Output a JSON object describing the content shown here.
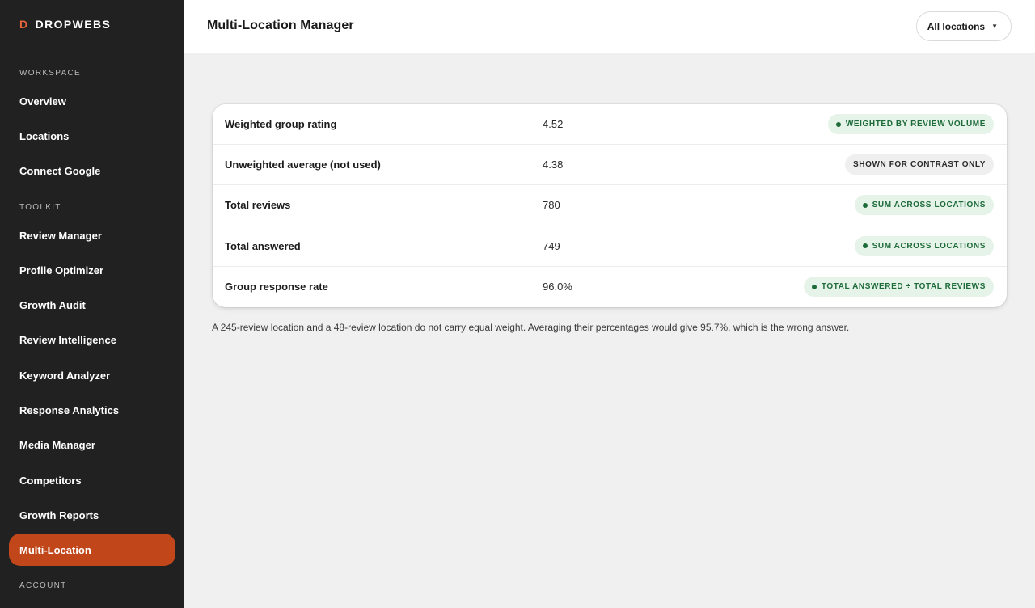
{
  "brand": {
    "mark": "D",
    "name": "DROPWEBS"
  },
  "sidebar": {
    "sections": [
      {
        "label": "WORKSPACE"
      },
      {
        "label": "TOOLKIT"
      },
      {
        "label": "ACCOUNT"
      }
    ],
    "items": [
      {
        "label": "Overview"
      },
      {
        "label": "Locations"
      },
      {
        "label": "Connect Google"
      },
      {
        "label": "Review Manager"
      },
      {
        "label": "Profile Optimizer"
      },
      {
        "label": "Growth Audit"
      },
      {
        "label": "Review Intelligence"
      },
      {
        "label": "Keyword Analyzer"
      },
      {
        "label": "Response Analytics"
      },
      {
        "label": "Media Manager"
      },
      {
        "label": "Competitors"
      },
      {
        "label": "Growth Reports"
      },
      {
        "label": "Multi-Location",
        "active": true
      }
    ]
  },
  "header": {
    "title": "Multi-Location Manager",
    "location_select": "All locations"
  },
  "rows": [
    {
      "label": "Weighted group rating",
      "value": "4.52",
      "badge": "WEIGHTED BY REVIEW VOLUME",
      "badge_style": "green"
    },
    {
      "label": "Unweighted average (not used)",
      "value": "4.38",
      "badge": "SHOWN FOR CONTRAST ONLY",
      "badge_style": "gray"
    },
    {
      "label": "Total reviews",
      "value": "780",
      "badge": "SUM ACROSS LOCATIONS",
      "badge_style": "green"
    },
    {
      "label": "Total answered",
      "value": "749",
      "badge": "SUM ACROSS LOCATIONS",
      "badge_style": "green"
    },
    {
      "label": "Group response rate",
      "value": "96.0%",
      "badge": "TOTAL ANSWERED ÷ TOTAL REVIEWS",
      "badge_style": "green"
    }
  ],
  "footnote": "A 245-review location and a 48-review location do not carry equal weight. Averaging their percentages would give 95.7%, which is the wrong answer.",
  "colors": {
    "sidebar_bg": "#212121",
    "accent": "#c1471b",
    "brand_mark": "#e8643a",
    "badge_green_bg": "#e5f3e9",
    "badge_green_text": "#1e6b3a"
  }
}
